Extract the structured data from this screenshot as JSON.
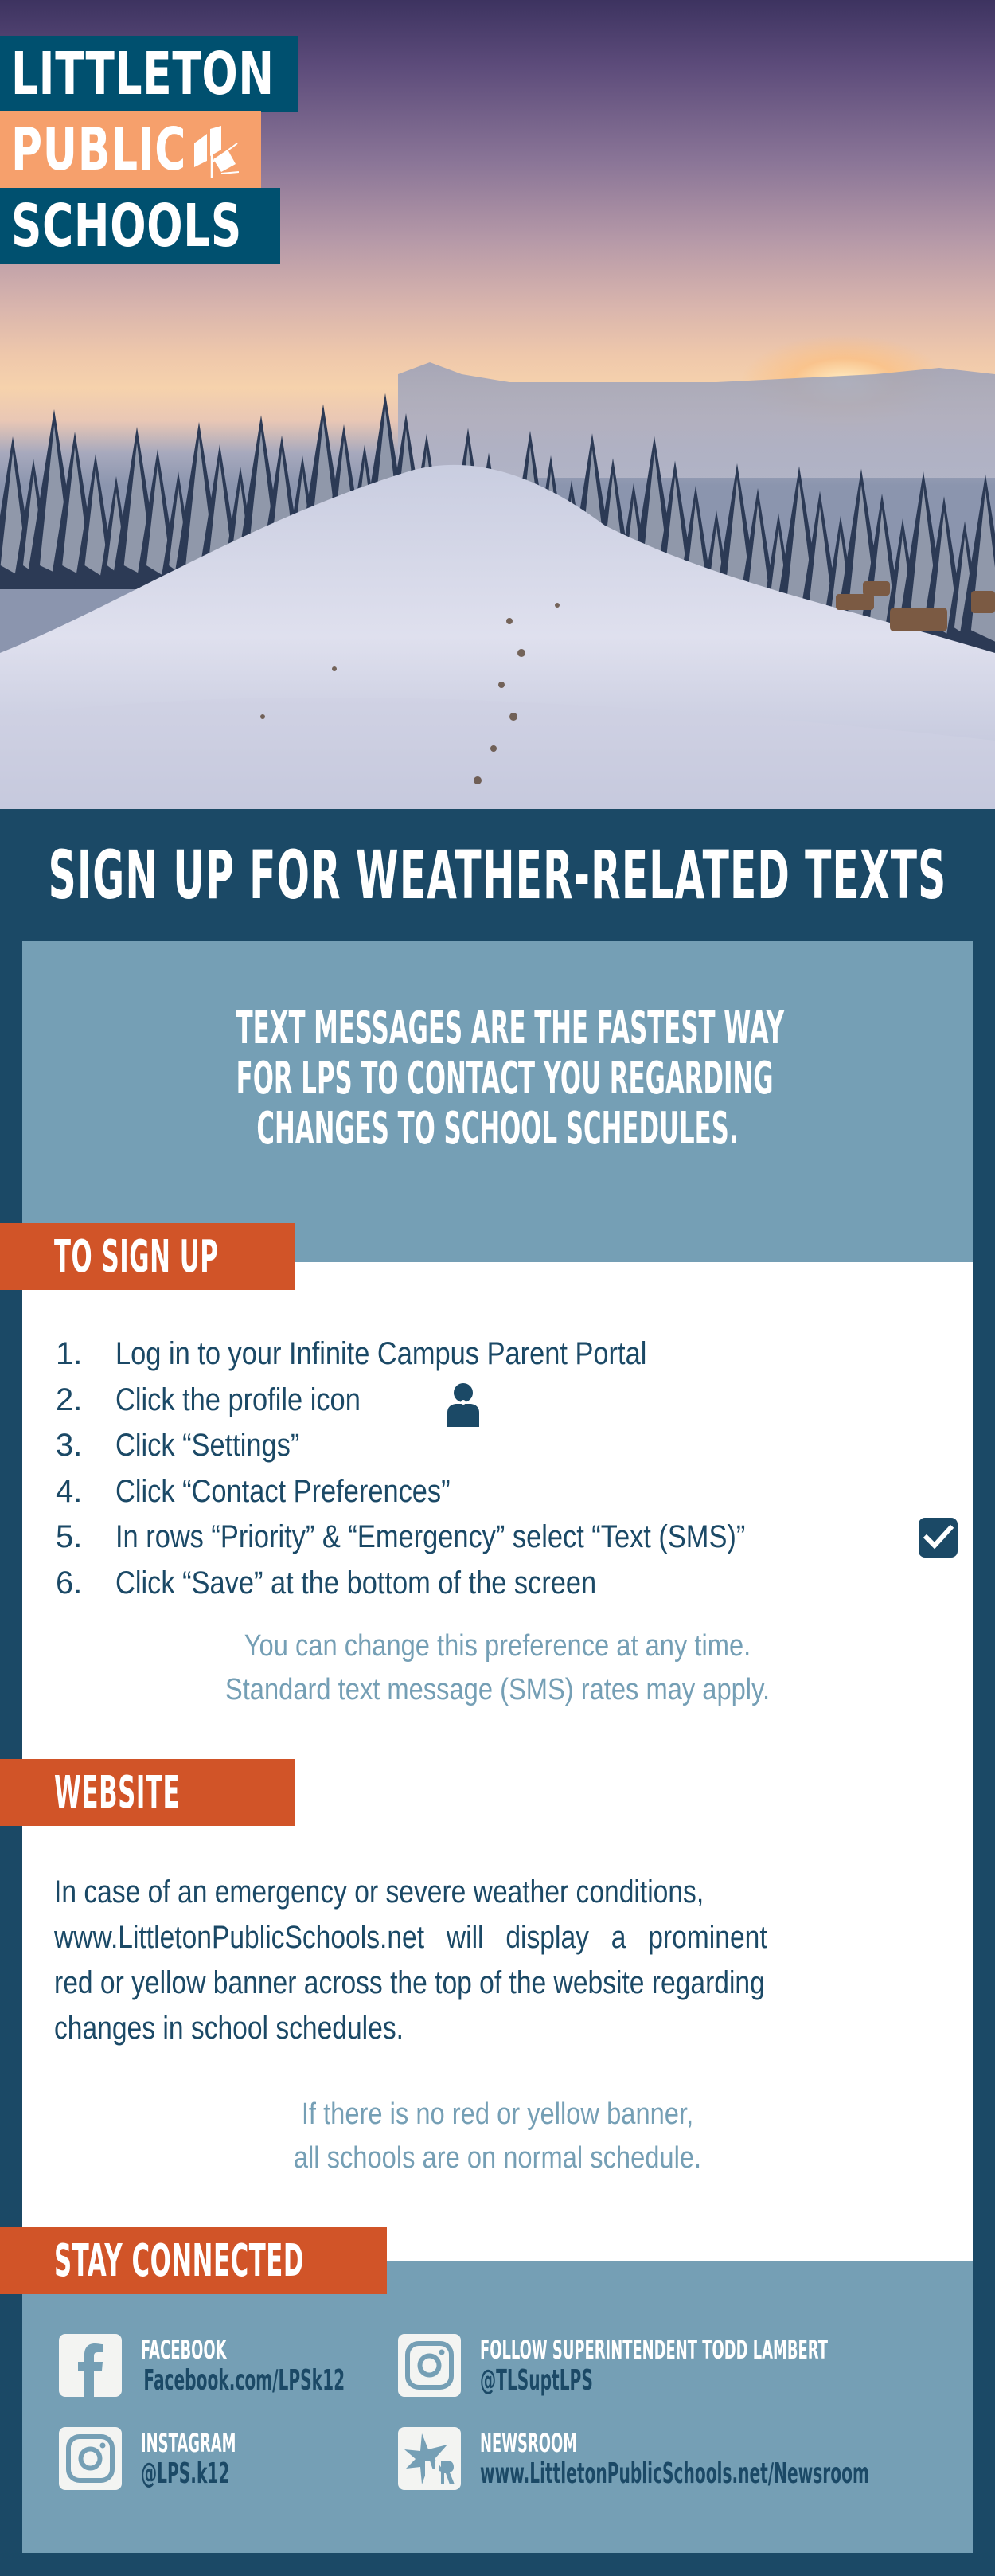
{
  "logo": {
    "line1": "LITTLETON",
    "line2": "PUBLIC",
    "line3": "SCHOOLS",
    "mark_icon": "lps-book-logo-icon"
  },
  "title": "SIGN UP FOR WEATHER-RELATED TEXTS",
  "intro": {
    "lines": [
      "TEXT MESSAGES ARE THE FASTEST WAY",
      "FOR LPS TO CONTACT YOU REGARDING",
      "CHANGES TO SCHOOL SCHEDULES."
    ]
  },
  "signup": {
    "heading": "TO SIGN UP",
    "steps": [
      {
        "num": "1.",
        "text": "Log in to your Infinite Campus Parent Portal"
      },
      {
        "num": "2.",
        "text": "Click the profile icon",
        "icon": "profile-icon"
      },
      {
        "num": "3.",
        "text": "Click “Settings”"
      },
      {
        "num": "4.",
        "text": "Click “Contact Preferences”"
      },
      {
        "num": "5.",
        "text": "In rows “Priority” & “Emergency” select “Text (SMS)”",
        "icon": "checkbox-checked-icon"
      },
      {
        "num": "6.",
        "text": "Click “Save” at the bottom of the screen"
      }
    ],
    "note_lines": [
      "You can change this preference at any time.",
      "Standard text message (SMS) rates may apply."
    ]
  },
  "website": {
    "heading": "WEBSITE",
    "lines": [
      "In case of an emergency or severe weather conditions,",
      "www.LittletonPublicSchools.net will display a prominent",
      "red or yellow banner across the top of the website regarding",
      "changes in school schedules."
    ],
    "note_lines": [
      "If there is no red or yellow banner,",
      "all schools are on normal schedule."
    ]
  },
  "connect": {
    "heading": "STAY CONNECTED",
    "items": [
      {
        "label": "FACEBOOK",
        "value": "Facebook.com/LPSk12",
        "icon": "facebook-icon"
      },
      {
        "label": "INSTAGRAM",
        "value": "@LPS.k12",
        "icon": "instagram-icon"
      },
      {
        "label": "FOLLOW SUPERINTENDENT TODD LAMBERT",
        "value": "@TLSuptLPS",
        "icon": "instagram-icon"
      },
      {
        "label": "NEWSROOM",
        "value": "www.LittletonPublicSchools.net/Newsroom",
        "icon": "newsroom-icon"
      }
    ]
  },
  "colors": {
    "navy": "#1b4966",
    "logo_blue": "#00506f",
    "logo_peach": "#f6a06c",
    "steel_blue": "#759fb5",
    "orange": "#d15428",
    "white": "#ffffff"
  }
}
